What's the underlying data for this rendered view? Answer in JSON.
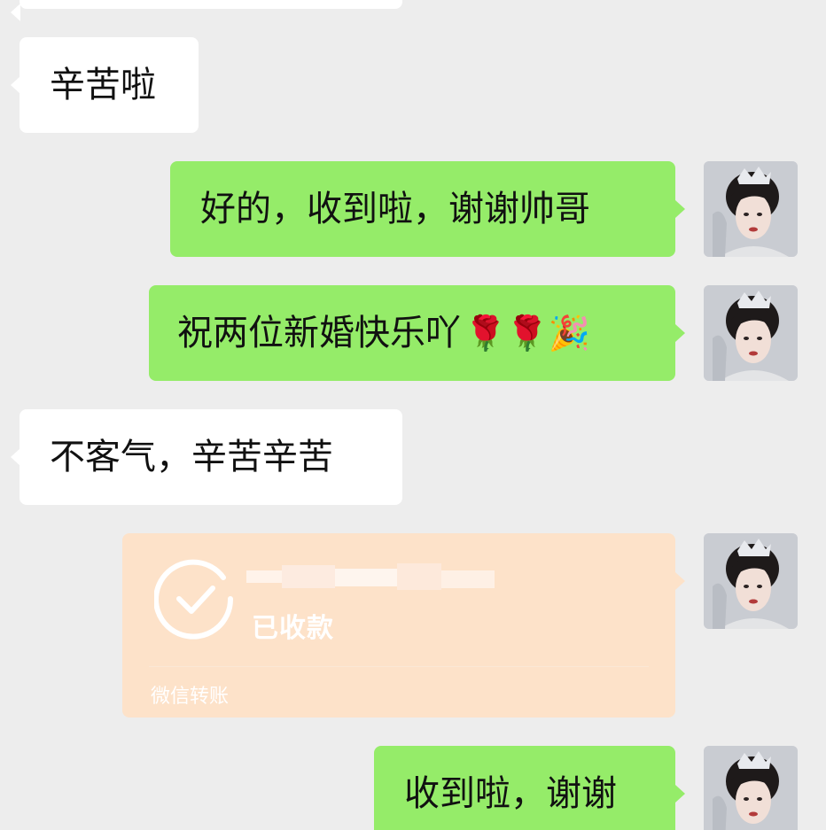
{
  "messages": [
    {
      "side": "left",
      "text": ""
    },
    {
      "side": "left",
      "text": "辛苦啦"
    },
    {
      "side": "right",
      "text": "好的，收到啦，谢谢帅哥"
    },
    {
      "side": "right",
      "text": "祝两位新婚快乐吖",
      "emoji": "🌹🌹🎉"
    },
    {
      "side": "left",
      "text": "不客气，辛苦辛苦"
    },
    {
      "side": "right",
      "type": "transfer",
      "status": "已收款",
      "footer": "微信转账"
    },
    {
      "side": "right",
      "text": "收到啦，谢谢"
    }
  ],
  "colors": {
    "background": "#ededed",
    "bubble_left": "#ffffff",
    "bubble_right": "#95ec69",
    "transfer_bg": "#fde2c9"
  },
  "icons": {
    "transfer": "checkmark-circle-icon",
    "avatar": "avatar"
  }
}
